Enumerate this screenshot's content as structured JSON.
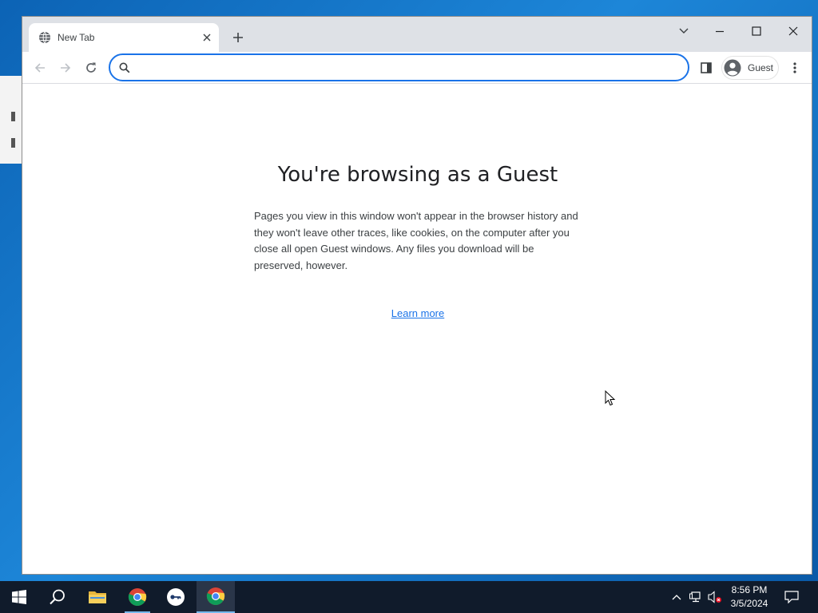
{
  "browser": {
    "tab": {
      "title": "New Tab",
      "favicon": "globe-icon"
    },
    "new_tab_icon": "plus-icon",
    "window_controls": [
      "tab-search-icon",
      "minimize-icon",
      "maximize-icon",
      "close-icon"
    ],
    "toolbar": {
      "back_icon": "back-arrow-icon",
      "forward_icon": "forward-arrow-icon",
      "reload_icon": "reload-icon",
      "omnibox": {
        "value": "",
        "placeholder": ""
      },
      "side_panel_icon": "side-panel-icon",
      "profile": {
        "label": "Guest",
        "icon": "person-avatar-icon"
      },
      "menu_icon": "kebab-menu-icon"
    },
    "page": {
      "title": "You're browsing as a Guest",
      "body": "Pages you view in this window won't appear in the browser history and they won't leave other traces, like cookies, on the computer after you close all open Guest windows. Any files you download will be preserved, however.",
      "link": "Learn more"
    }
  },
  "taskbar": {
    "items": [
      "start-windows-icon",
      "search-icon",
      "file-explorer-icon",
      "chrome-icon",
      "password-manager-icon",
      "chrome-icon"
    ],
    "tray": [
      "show-hidden-icons-chevron",
      "network-icon",
      "volume-muted-icon",
      "notifications-icon"
    ],
    "clock": {
      "time": "8:56 PM",
      "date": "3/5/2024"
    }
  },
  "colors": {
    "accent": "#1a73e8",
    "tab_strip": "#dee1e6",
    "taskbar": "#101b2b",
    "desktop": "#1d86d8"
  }
}
